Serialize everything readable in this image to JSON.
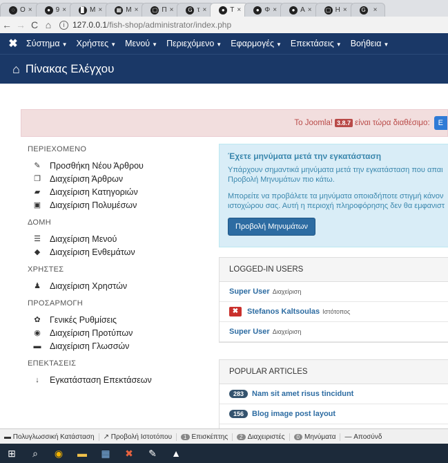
{
  "browser": {
    "tabs": [
      {
        "icon": "◌",
        "label": "O"
      },
      {
        "icon": "●",
        "label": "9"
      },
      {
        "icon": "▊",
        "label": "M"
      },
      {
        "icon": "▦",
        "label": "M"
      },
      {
        "icon": "▢",
        "label": "Π"
      },
      {
        "icon": "G",
        "label": "τ"
      },
      {
        "icon": "●",
        "label": "T"
      },
      {
        "icon": "●",
        "label": "Φ"
      },
      {
        "icon": "●",
        "label": "A"
      },
      {
        "icon": "▢",
        "label": "H"
      },
      {
        "icon": "G",
        "label": ""
      }
    ],
    "url_host": "127.0.0.1",
    "url_path": "/fish-shop/administrator/index.php"
  },
  "topmenu": [
    "Σύστημα",
    "Χρήστες",
    "Μενού",
    "Περιεχόμενο",
    "Εφαρμογές",
    "Επεκτάσεις",
    "Βοήθεια"
  ],
  "header": {
    "title": "Πίνακας Ελέγχου"
  },
  "alert": {
    "text_before": "Το Joomla!",
    "version": "3.8.7",
    "text_after": "είναι τώρα διαθέσιμο:",
    "button": "E"
  },
  "sidebar": {
    "sections": [
      {
        "title": "ΠΕΡΙΕΧΟΜΕΝΟ",
        "items": [
          {
            "icon": "pencil-icon",
            "glyph": "✎",
            "label": "Προσθήκη Νέου Άρθρου"
          },
          {
            "icon": "copy-icon",
            "glyph": "❐",
            "label": "Διαχείριση Άρθρων"
          },
          {
            "icon": "folder-icon",
            "glyph": "▰",
            "label": "Διαχείριση Κατηγοριών"
          },
          {
            "icon": "image-icon",
            "glyph": "▣",
            "label": "Διαχείριση Πολυμέσων"
          }
        ]
      },
      {
        "title": "ΔΟΜΗ",
        "items": [
          {
            "icon": "list-icon",
            "glyph": "☰",
            "label": "Διαχείριση Μενού"
          },
          {
            "icon": "cube-icon",
            "glyph": "◆",
            "label": "Διαχείριση Ενθεμάτων"
          }
        ]
      },
      {
        "title": "ΧΡΗΣΤΕΣ",
        "items": [
          {
            "icon": "users-icon",
            "glyph": "♟",
            "label": "Διαχείριση Χρηστών"
          }
        ]
      },
      {
        "title": "ΠΡΟΣΑΡΜΟΓΗ",
        "items": [
          {
            "icon": "cog-icon",
            "glyph": "✿",
            "label": "Γενικές Ρυθμίσεις"
          },
          {
            "icon": "eye-icon",
            "glyph": "◉",
            "label": "Διαχείριση Προτύπων"
          },
          {
            "icon": "comments-icon",
            "glyph": "▬",
            "label": "Διαχείριση Γλωσσών"
          }
        ]
      },
      {
        "title": "ΕΠΕΚΤΑΣΕΙΣ",
        "items": [
          {
            "icon": "upload-icon",
            "glyph": "↓",
            "label": "Εγκατάσταση Επεκτάσεων"
          }
        ]
      }
    ]
  },
  "postinstall": {
    "title": "Έχετε μηνύματα μετά την εγκατάσταση",
    "line1": "Υπάρχουν σημαντικά μηνύματα μετά την εγκατάσταση που απαι",
    "line2": "Προβολή Μηνυμάτων πιο κάτω.",
    "line3": "Μπορείτε να προβάλετε τα μηνύματα οποιαδήποτε στιγμή κάνον",
    "line4": "ιστοχώρου σας. Αυτή η περιοχή πληροφόρησης δεν θα εμφανιστ",
    "button": "Προβολή Μηνυμάτων"
  },
  "logged_in": {
    "header": "LOGGED-IN USERS",
    "rows": [
      {
        "name": "Super User",
        "area": "Διαχείριση",
        "logout": false
      },
      {
        "name": "Stefanos Kaltsoulas",
        "area": "Ιστότοπος",
        "logout": true
      },
      {
        "name": "Super User",
        "area": "Διαχείριση",
        "logout": false
      }
    ]
  },
  "popular": {
    "header": "POPULAR ARTICLES",
    "rows": [
      {
        "count": "283",
        "title": "Nam sit amet risus tincidunt"
      },
      {
        "count": "156",
        "title": "Blog image post layout"
      }
    ]
  },
  "statusbar": {
    "multilang": "Πολυγλωσσική Κατάσταση",
    "preview": "Προβολή Ιστοτόπου",
    "visitors_count": "1",
    "visitors": "Επισκέπτης",
    "admins_count": "2",
    "admins": "Διαχειριστές",
    "messages_count": "0",
    "messages": "Μηνύματα",
    "logout": "Αποσύνδ"
  }
}
